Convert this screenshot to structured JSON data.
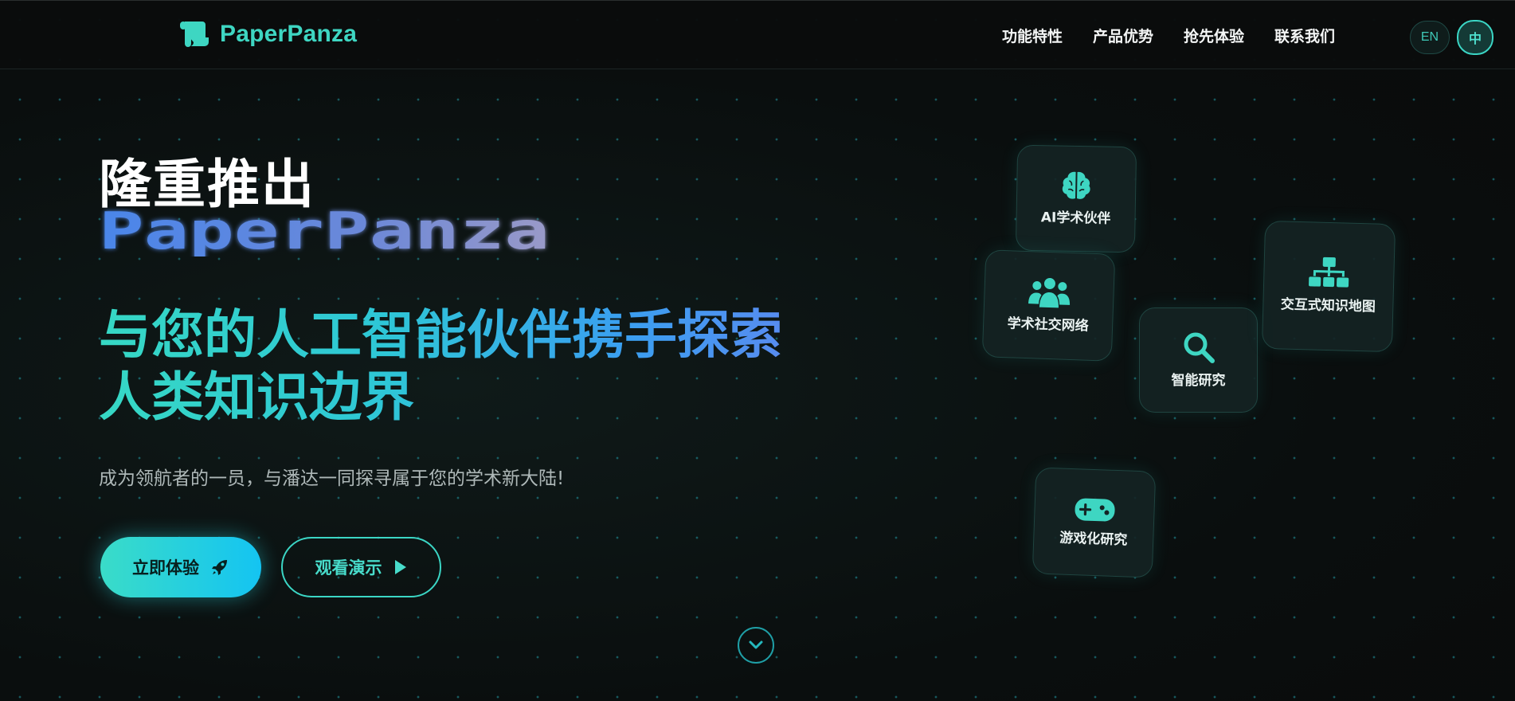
{
  "nav": {
    "brand": "PaperPanza",
    "links": [
      "功能特性",
      "产品优势",
      "抢先体验",
      "联系我们"
    ],
    "lang_en": "EN",
    "lang_zh": "中"
  },
  "hero": {
    "pre_title": "隆重推出",
    "pixel_title": "PaperPanza",
    "headline_line1": "与您的人工智能伙伴携手探索",
    "headline_line2": "人类知识边界",
    "subtitle": "成为领航者的一员，与潘达一同探寻属于您的学术新大陆!",
    "primary_button": "立即体验",
    "secondary_button": "观看演示"
  },
  "features": [
    {
      "label": "AI学术伙伴",
      "icon": "brain-icon"
    },
    {
      "label": "学术社交网络",
      "icon": "users-icon"
    },
    {
      "label": "智能研究",
      "icon": "search-icon"
    },
    {
      "label": "交互式知识地图",
      "icon": "sitemap-icon"
    },
    {
      "label": "游戏化研究",
      "icon": "gamepad-icon"
    }
  ],
  "colors": {
    "accent": "#3ed6c2",
    "accent_blue": "#14c4f2",
    "background": "#0a0d0d"
  }
}
